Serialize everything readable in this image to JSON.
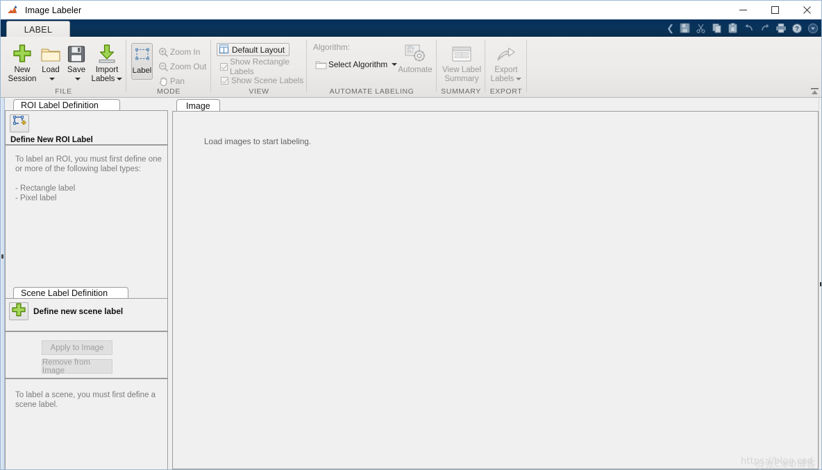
{
  "window": {
    "title": "Image Labeler",
    "app_icon": "matlab-membrane-icon",
    "minimize": "—",
    "maximize": "□",
    "close": "✕"
  },
  "quick_access": {
    "chevron": "❮",
    "items": [
      {
        "name": "save-icon",
        "title": "Save"
      },
      {
        "name": "cut-icon",
        "title": "Cut"
      },
      {
        "name": "copy-icon",
        "title": "Copy"
      },
      {
        "name": "paste-icon",
        "title": "Paste"
      },
      {
        "name": "undo-icon",
        "title": "Undo"
      },
      {
        "name": "redo-icon",
        "title": "Redo"
      },
      {
        "name": "print-icon",
        "title": "Print"
      },
      {
        "name": "help-icon",
        "title": "Help"
      },
      {
        "name": "qat-dropdown-icon",
        "title": "Customize"
      }
    ]
  },
  "ribbon": {
    "tab": "LABEL",
    "collapse_tooltip": "Minimize Ribbon",
    "groups": {
      "file": {
        "title": "FILE",
        "buttons": [
          {
            "label_line1": "New",
            "label_line2": "Session",
            "icon": "new-session-icon",
            "has_caret": false
          },
          {
            "label_line1": "Load",
            "label_line2": "",
            "icon": "load-folder-icon",
            "has_caret": true
          },
          {
            "label_line1": "Save",
            "label_line2": "",
            "icon": "save-disk-icon",
            "has_caret": true
          },
          {
            "label_line1": "Import",
            "label_line2": "Labels",
            "icon": "import-labels-icon",
            "has_caret": true
          }
        ]
      },
      "mode": {
        "title": "MODE",
        "label_button": "Label",
        "label_button_icon": "roi-select-icon",
        "items": [
          {
            "label": "Zoom In",
            "icon": "zoom-in-icon",
            "disabled": true
          },
          {
            "label": "Zoom Out",
            "icon": "zoom-out-icon",
            "disabled": true
          },
          {
            "label": "Pan",
            "icon": "pan-hand-icon",
            "disabled": true
          }
        ]
      },
      "view": {
        "title": "VIEW",
        "default_layout": "Default Layout",
        "default_layout_icon": "layout-grid-icon",
        "checkboxes": [
          {
            "label": "Show Rectangle Labels",
            "checked": true,
            "disabled": true
          },
          {
            "label": "Show Scene Labels",
            "checked": true,
            "disabled": true
          }
        ]
      },
      "automate": {
        "title": "AUTOMATE LABELING",
        "algorithm_label": "Algorithm:",
        "select_algorithm": "Select Algorithm",
        "select_algorithm_icon": "folder-small-icon",
        "automate_label": "Automate",
        "automate_icon": "automate-gear-icon"
      },
      "summary": {
        "title": "SUMMARY",
        "label_line1": "View Label",
        "label_line2": "Summary",
        "icon": "label-summary-icon"
      },
      "export": {
        "title": "EXPORT",
        "label_line1": "Export",
        "label_line2": "Labels",
        "icon": "export-arrow-icon",
        "has_caret": true
      }
    }
  },
  "roi_panel": {
    "tab": "ROI Label Definition",
    "tool_icon": "define-new-roi-icon",
    "tool_label": "Define New ROI Label",
    "help_lines": [
      "To label an ROI, you must first define one",
      "or more of the following label types:",
      "",
      "- Rectangle label",
      "- Pixel label"
    ]
  },
  "scene_panel": {
    "tab": "Scene Label Definition",
    "add_icon": "define-new-scene-label-icon",
    "add_label": "Define new scene label",
    "apply_button": "Apply to Image",
    "remove_button": "Remove from Image",
    "help_lines": [
      "To label a scene, you must first define a",
      "scene label."
    ]
  },
  "center_panel": {
    "tab": "Image",
    "hint": "Load images to start labeling."
  },
  "watermark": {
    "url": "https://blog.csd",
    "overlay": "@张C⊕O博客"
  },
  "colors": {
    "titlebar_bg": "#ffffff",
    "ribbon_band": "#093359",
    "ribbon_bg": "#efedeb",
    "panel_bg": "#f0f0f0",
    "accent_blue": "#1b6fb5",
    "green_plus": "#7cc242",
    "folder_yellow": "#f2d89b",
    "help_text": "#7b7b7b"
  }
}
